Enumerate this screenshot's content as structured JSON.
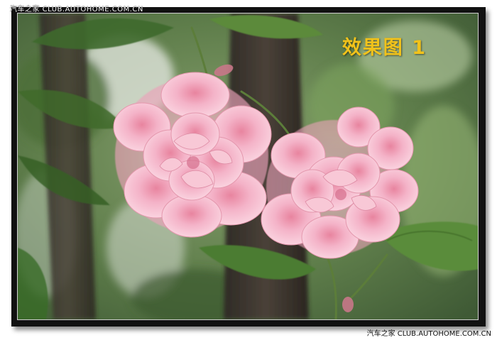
{
  "watermark_top": "汽车之家 CLUB.AUTOHOME.COM.CN",
  "caption": "效果图 1",
  "watermark_bottom": {
    "site": "汽车之家",
    "url": "CLUB.AUTOHOME.COM.CN"
  },
  "colors": {
    "caption": "#f1c21b",
    "frame": "#111111",
    "blossom": "#f3a9c2",
    "leaf": "#4f7b34"
  },
  "image_subject": [
    "pink-double-cherry-blossom",
    "green-leaves",
    "dark-tree-trunk"
  ]
}
